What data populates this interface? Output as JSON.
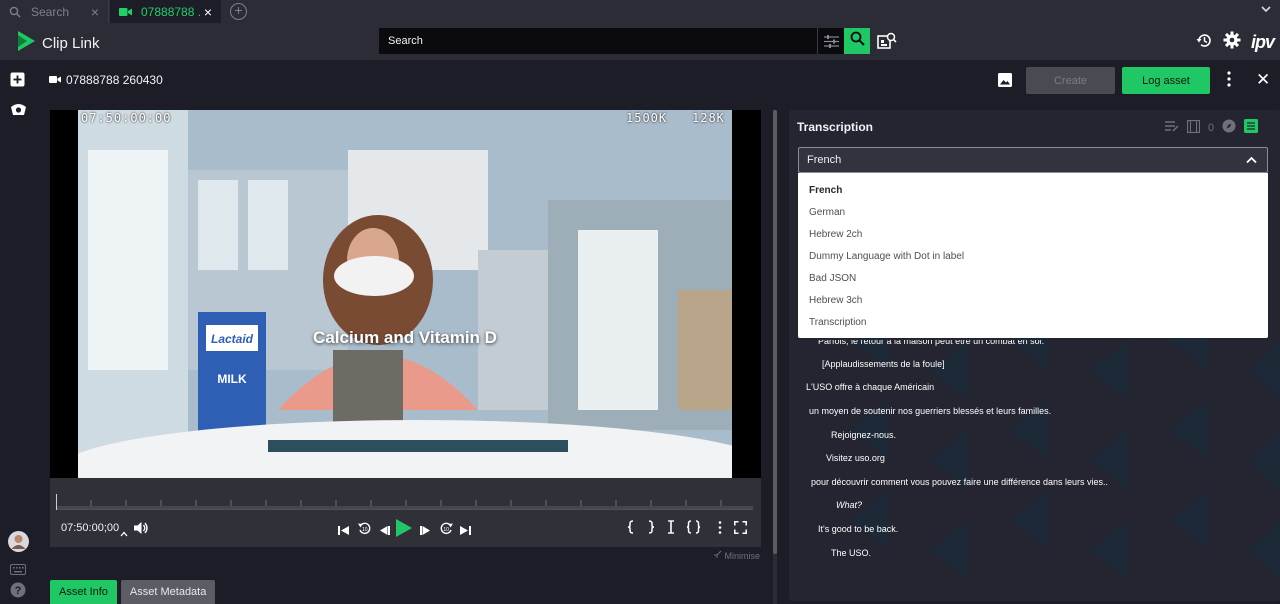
{
  "tabs": {
    "search_label": "Search",
    "active_label": "07888788 ...",
    "close_glyph": "×",
    "add_glyph": "+"
  },
  "app": {
    "title": "Clip Link",
    "brand": "ipv",
    "accent": "#20c765"
  },
  "search": {
    "placeholder": "Search"
  },
  "asset": {
    "title": "07888788 260430",
    "create_label": "Create",
    "log_label": "Log asset",
    "close_glyph": "✕"
  },
  "video": {
    "timecode_overlay": "07:50:00:00",
    "video_bitrate": "1500K",
    "audio_bitrate": "128K",
    "subtitle": "Calcium and Vitamin D",
    "timecode": "07:50:00;00",
    "minimise_label": "Minimise"
  },
  "bottom_tabs": [
    {
      "label": "Asset Info",
      "active": true
    },
    {
      "label": "Asset Metadata",
      "active": false
    }
  ],
  "transcription": {
    "title": "Transcription",
    "clip_count": "0",
    "selected_language": "French",
    "options": [
      "French",
      "German",
      "Hebrew 2ch",
      "Dummy Language with Dot in label",
      "Bad JSON",
      "Hebrew 3ch",
      "Transcription"
    ],
    "lines": [
      {
        "text": "Parfois, le retour à la maison peut être un combat en soi.",
        "italic": false
      },
      {
        "text": "[Applaudissements de la foule]",
        "italic": false
      },
      {
        "text": "L'USO offre à chaque Américain",
        "italic": false
      },
      {
        "text": "un moyen de soutenir nos guerriers blessés et leurs familles.",
        "italic": false
      },
      {
        "text": "Rejoignez-nous.",
        "italic": false
      },
      {
        "text": "Visitez uso.org",
        "italic": false
      },
      {
        "text": "pour découvrir comment vous pouvez faire une différence dans leurs vies..",
        "italic": false
      },
      {
        "text": "What?",
        "italic": true
      },
      {
        "text": "It's good to be back.",
        "italic": false,
        "italic_prefix": "It's"
      },
      {
        "text": "The USO.",
        "italic": false
      }
    ]
  },
  "icons": [
    "search-icon",
    "video-camera-icon",
    "close-icon",
    "add-tab-icon",
    "chevron-down-icon",
    "clip-link-logo-icon",
    "filter-sliders-icon",
    "advanced-search-icon",
    "history-icon",
    "gear-icon",
    "add-box-icon",
    "crown-icon",
    "avatar",
    "keyboard-icon",
    "help-icon",
    "image-icon",
    "kebab-icon",
    "volume-icon",
    "skip-start-icon",
    "rewind-icon",
    "frame-back-icon",
    "play-icon",
    "frame-forward-icon",
    "forward-icon",
    "skip-end-icon",
    "chevron-up-icon"
  ]
}
